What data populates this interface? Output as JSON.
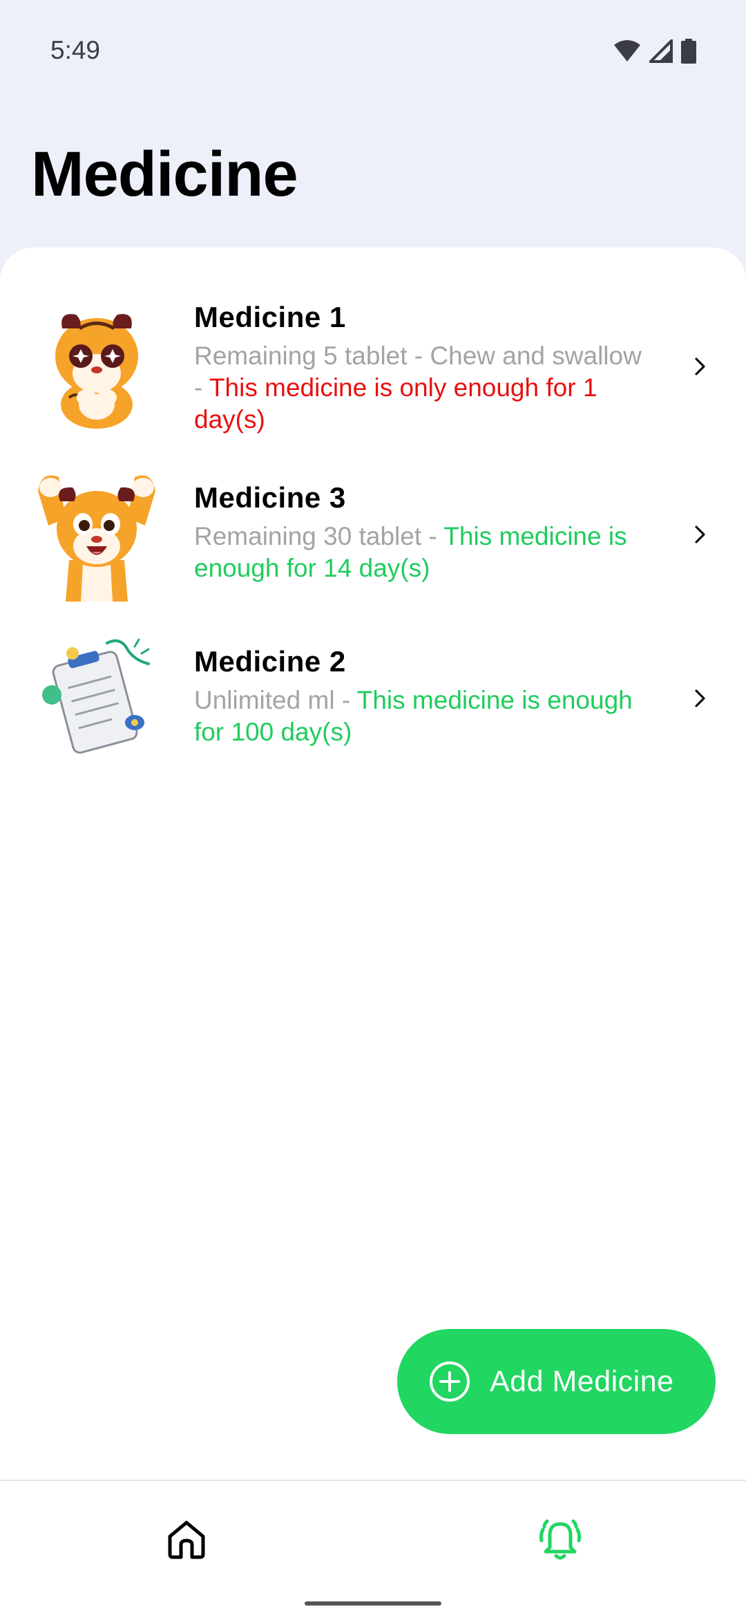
{
  "status_bar": {
    "time": "5:49"
  },
  "header": {
    "title": "Medicine"
  },
  "medicines": [
    {
      "name": "Medicine 1",
      "desc_gray": "Remaining 5 tablet - Chew and swallow - ",
      "desc_status": "This medicine is only enough for 1 day(s)",
      "status_color": "#e81010",
      "thumbnail": "tiger-sticker-shy"
    },
    {
      "name": "Medicine 3",
      "desc_gray": "Remaining 30 tablet - ",
      "desc_status": "This medicine is enough for 14 day(s)",
      "status_color": "#1fcc5c",
      "thumbnail": "tiger-sticker-cheer"
    },
    {
      "name": "Medicine 2",
      "desc_gray": "Unlimited ml - ",
      "desc_status": "This medicine is enough for 100 day(s)",
      "status_color": "#1fcc5c",
      "thumbnail": "eye-test-sticker"
    }
  ],
  "fab": {
    "label": "Add Medicine",
    "icon": "plus-circle-icon"
  },
  "bottom_nav": {
    "items": [
      {
        "icon": "home-icon",
        "active": false
      },
      {
        "icon": "bell-icon",
        "active": true
      }
    ]
  },
  "colors": {
    "accent": "#21d661",
    "danger": "#e81010",
    "background": "#edf0f9"
  }
}
